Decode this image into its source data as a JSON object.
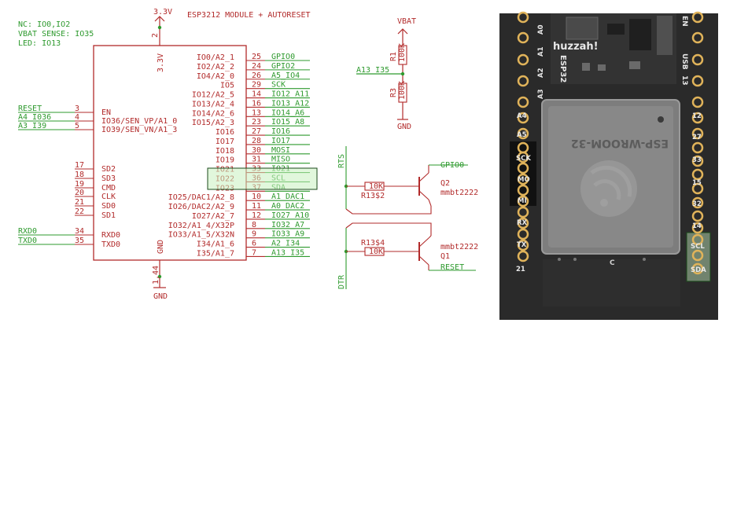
{
  "notes": {
    "nc": "NC: IO0,IO2",
    "vbat": "VBAT SENSE: IO35",
    "led": "LED: IO13"
  },
  "title": "ESP3212 MODULE + AUTORESET",
  "power": {
    "v33": "3.3V",
    "v33_pin": "2",
    "v33_inside": "3.3V",
    "gnd": "GND",
    "gnd_pins": "1,44",
    "gnd_inside": "GND",
    "vbat": "VBAT",
    "a13_net": "A13_I35",
    "r1": "R1",
    "r1_val": "100K",
    "r3": "R3",
    "r3_val": "100K",
    "r_gnd": "GND"
  },
  "left_pins": [
    {
      "net": "RESET",
      "num": "3",
      "name": "EN"
    },
    {
      "net": "A4_I036",
      "num": "4",
      "name": "IO36/SEN_VP/A1_0"
    },
    {
      "net": "A3_I39",
      "num": "5",
      "name": "IO39/SEN_VN/A1_3"
    },
    {
      "net": "",
      "num": "17",
      "name": "SD2"
    },
    {
      "net": "",
      "num": "18",
      "name": "SD3"
    },
    {
      "net": "",
      "num": "19",
      "name": "CMD"
    },
    {
      "net": "",
      "num": "20",
      "name": "CLK"
    },
    {
      "net": "",
      "num": "21",
      "name": "SD0"
    },
    {
      "net": "",
      "num": "22",
      "name": "SD1"
    },
    {
      "net": "RXD0",
      "num": "34",
      "name": "RXD0"
    },
    {
      "net": "TXD0",
      "num": "35",
      "name": "TXD0"
    }
  ],
  "right_pins": [
    {
      "inside": "IO0/A2_1",
      "num": "25",
      "net": "GPIO0"
    },
    {
      "inside": "IO2/A2_2",
      "num": "24",
      "net": "GPIO2"
    },
    {
      "inside": "IO4/A2_0",
      "num": "26",
      "net": "A5_IO4"
    },
    {
      "inside": "IO5",
      "num": "29",
      "net": "SCK"
    },
    {
      "inside": "IO12/A2_5",
      "num": "14",
      "net": "IO12_A11"
    },
    {
      "inside": "IO13/A2_4",
      "num": "16",
      "net": "IO13_A12"
    },
    {
      "inside": "IO14/A2_6",
      "num": "13",
      "net": "IO14_A6"
    },
    {
      "inside": "IO15/A2_3",
      "num": "23",
      "net": "IO15_A8"
    },
    {
      "inside": "IO16",
      "num": "27",
      "net": "IO16"
    },
    {
      "inside": "IO17",
      "num": "28",
      "net": "IO17"
    },
    {
      "inside": "IO18",
      "num": "30",
      "net": "MOSI"
    },
    {
      "inside": "IO19",
      "num": "31",
      "net": "MISO"
    },
    {
      "inside": "IO21",
      "num": "33",
      "net": "IO21"
    },
    {
      "inside": "IO22",
      "num": "36",
      "net": "SCL"
    },
    {
      "inside": "IO23",
      "num": "37",
      "net": "SDA"
    },
    {
      "inside": "IO25/DAC1/A2_8",
      "num": "10",
      "net": "A1_DAC1"
    },
    {
      "inside": "IO26/DAC2/A2_9",
      "num": "11",
      "net": "A0_DAC2"
    },
    {
      "inside": "IO27/A2_7",
      "num": "12",
      "net": "IO27_A10"
    },
    {
      "inside": "IO32/A1_4/X32P",
      "num": "8",
      "net": "IO32_A7"
    },
    {
      "inside": "IO33/A1_5/X32N",
      "num": "9",
      "net": "IO33_A9"
    },
    {
      "inside": "I34/A1_6",
      "num": "6",
      "net": "A2_I34"
    },
    {
      "inside": "I35/A1_7",
      "num": "7",
      "net": "A13_I35"
    }
  ],
  "autoreset": {
    "rts": "RTS",
    "dtr": "DTR",
    "r_top_name": "R13$2",
    "r_top_val": "10K",
    "r_bot_name": "R13$4",
    "r_bot_val": "10K",
    "q2_net": "GPIO0",
    "q2_name": "Q2",
    "q2_part": "mmbt2222",
    "q1_part": "mmbt2222",
    "q1_name": "Q1",
    "q1_net": "RESET"
  },
  "board": {
    "logo": "huzzah!",
    "module": "ESP-WROOM-32",
    "esp32": "ESP32",
    "usb": "USB",
    "en": "EN",
    "pin13": "13",
    "left_labels": [
      "A0",
      "A1",
      "A2",
      "A3",
      "",
      "A4",
      "A5",
      "SCK",
      "MO",
      "MI",
      "RX",
      "TX",
      "21"
    ],
    "right_labels": [
      "12",
      "27",
      "33",
      "15",
      "32",
      "14",
      "SCL",
      "SDA"
    ],
    "center_mark": "C"
  },
  "colors": {
    "schematic": "#b22b2b",
    "net": "#2e9a2e",
    "highlight_fill": "#c8f0c0",
    "highlight_stroke": "#1a4a1a",
    "pcb": "#272727",
    "pad": "#e0b35a"
  }
}
